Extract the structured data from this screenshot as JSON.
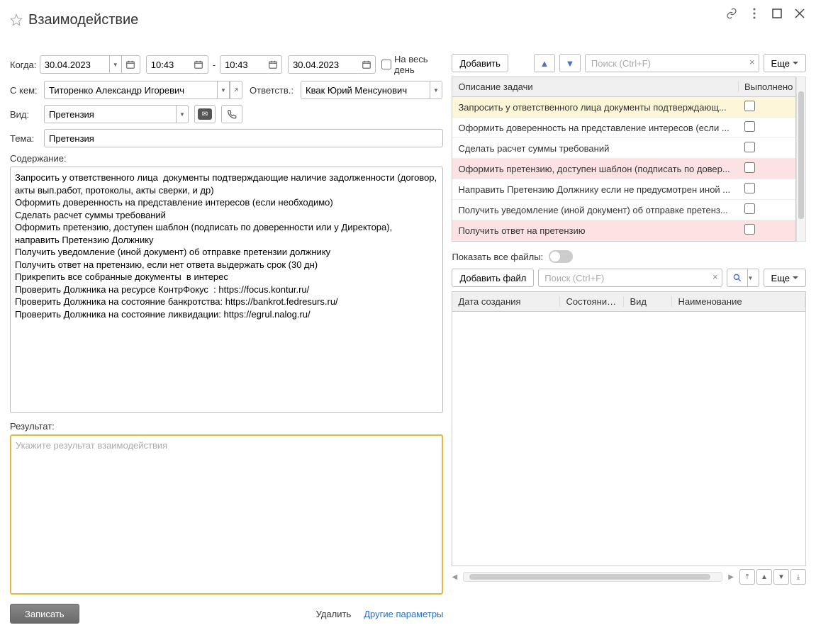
{
  "window": {
    "title": "Взаимодействие"
  },
  "form": {
    "when_label": "Когда:",
    "date_start": "30.04.2023",
    "time_start": "10:43",
    "time_end": "10:43",
    "date_end": "30.04.2023",
    "all_day_label": "На весь день",
    "with_label": "С кем:",
    "with_value": "Титоренко Александр Игоревич",
    "resp_label": "Ответств.:",
    "resp_value": "Квак Юрий Менсунович",
    "kind_label": "Вид:",
    "kind_value": "Претензия",
    "topic_label": "Тема:",
    "topic_value": "Претензия",
    "content_label": "Содержание:",
    "content_value": "Запросить у ответственного лица  документы подтверждающие наличие задолженности (договор, акты вып.работ, протоколы, акты сверки, и др)\nОформить доверенность на представление интересов (если необходимо)\nСделать расчет суммы требований\nОформить претензию, доступен шаблон (подписать по доверенности или у Директора), направить Претензию Должнику\nПолучить уведомление (иной документ) об отправке претензии должнику\nПолучить ответ на претензию, если нет ответа выдержать срок (30 дн)\nПрикрепить все собранные документы  в интерес\nПроверить Должника на ресурсе КонтрФокус  : https://focus.kontur.ru/\nПроверить Должника на состояние банкротства: https://bankrot.fedresurs.ru/\nПроверить Должника на состояние ликвидации: https://egrul.nalog.ru/",
    "result_label": "Результат:",
    "result_placeholder": "Укажите результат взаимодействия",
    "write_btn": "Записать",
    "delete_link": "Удалить",
    "other_params_link": "Другие параметры"
  },
  "tasks": {
    "add_btn": "Добавить",
    "search_placeholder": "Поиск (Ctrl+F)",
    "more_btn": "Еще",
    "col_desc": "Описание задачи",
    "col_done": "Выполнено",
    "rows": [
      {
        "desc": "Запросить у ответственного лица  документы подтверждающ...",
        "cls": "row-yellow"
      },
      {
        "desc": "Оформить доверенность на представление интересов (если ...",
        "cls": ""
      },
      {
        "desc": "Сделать расчет суммы требований",
        "cls": ""
      },
      {
        "desc": "Оформить претензию, доступен шаблон (подписать по довер...",
        "cls": "row-pink"
      },
      {
        "desc": "Направить Претензию Должнику если не предусмотрен иной ...",
        "cls": ""
      },
      {
        "desc": "Получить уведомление (иной документ) об отправке претенз...",
        "cls": ""
      },
      {
        "desc": "Получить ответ на претензию",
        "cls": "row-pink"
      }
    ]
  },
  "files": {
    "show_all_label": "Показать все файлы:",
    "add_file_btn": "Добавить файл",
    "search_placeholder": "Поиск (Ctrl+F)",
    "more_btn": "Еще",
    "col_created": "Дата создания",
    "col_state": "Состояние ...",
    "col_kind": "Вид",
    "col_name": "Наименование"
  }
}
